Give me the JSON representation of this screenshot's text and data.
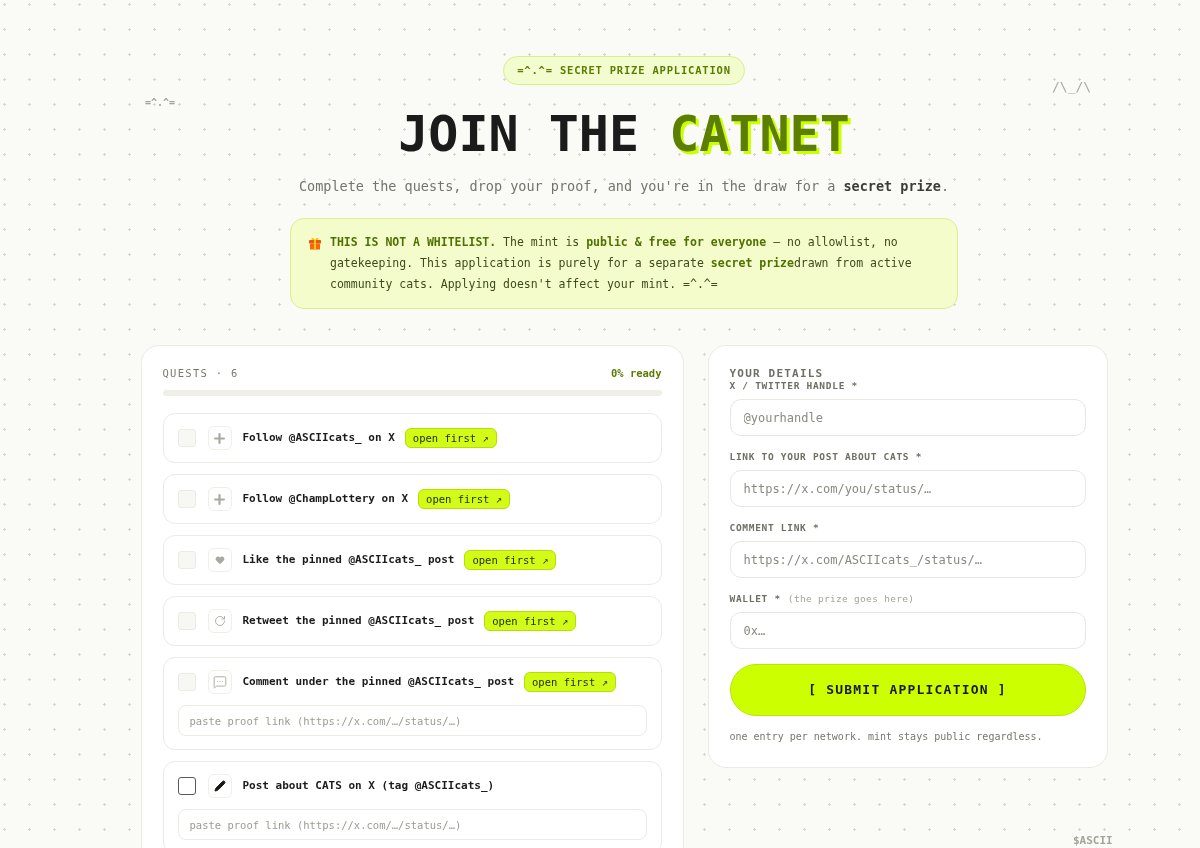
{
  "doodles": {
    "top_left": "=^.^=",
    "top_right": "/\\_/\\",
    "bottom_right": "$ASCII"
  },
  "hero": {
    "badge": "=^.^= SECRET PRIZE APPLICATION",
    "title": "JOIN THE **CATNET**",
    "subtitle": "Complete the quests, drop your proof, and you're in the draw for a **secret prize**."
  },
  "notice": {
    "text": "**THIS IS NOT A WHITELIST.** The mint is **public & free for everyone** — no allowlist, no gatekeeping. This application is purely for a separate **secret prize**drawn from active community cats. Applying doesn't affect your mint. =^.^="
  },
  "quests": {
    "title": "QUESTS · 6",
    "status": "0% ready",
    "progress": {
      "level": 0
    },
    "items": [
      {
        "kind": "follow",
        "label": "Follow @ASCIIcats_ on X",
        "action": "open first ↗",
        "checked": false,
        "disabled": true
      },
      {
        "kind": "follow",
        "label": "Follow @ChampLottery on X",
        "action": "open first ↗",
        "checked": false,
        "disabled": true
      },
      {
        "kind": "like",
        "label": "Like the pinned @ASCIIcats_ post",
        "action": "open first ↗",
        "checked": false,
        "disabled": true
      },
      {
        "kind": "retweet",
        "label": "Retweet the pinned @ASCIIcats_ post",
        "action": "open first ↗",
        "checked": false,
        "disabled": true
      },
      {
        "kind": "comment",
        "label": "Comment under the pinned @ASCIIcats_ post",
        "action": "open first ↗",
        "checked": false,
        "disabled": true,
        "proof_placeholder": "paste proof link (https://x.com/…/status/…)"
      },
      {
        "kind": "post",
        "label": "Post about CATS on X (tag @ASCIIcats_)",
        "checked": false,
        "disabled": false,
        "proof_placeholder": "paste proof link (https://x.com/…/status/…)"
      }
    ]
  },
  "details": {
    "title": "YOUR DETAILS",
    "fields": [
      {
        "label": "X / TWITTER HANDLE *",
        "placeholder": "@yourhandle"
      },
      {
        "label": "LINK TO YOUR POST ABOUT CATS *",
        "placeholder": "https://x.com/you/status/…"
      },
      {
        "label": "COMMENT LINK *",
        "placeholder": "https://x.com/ASCIIcats_/status/…"
      },
      {
        "label": "WALLET *",
        "hint": "(the prize goes here)",
        "placeholder": "0x…"
      }
    ],
    "submit": "[ SUBMIT APPLICATION ]",
    "footnote": "one entry per network. mint stays public regardless."
  }
}
